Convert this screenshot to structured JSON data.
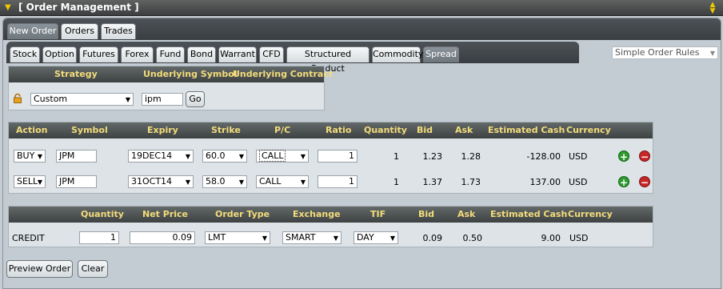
{
  "window": {
    "title": "[ Order Management ]"
  },
  "top_tabs": [
    "New Order",
    "Orders",
    "Trades"
  ],
  "instrument_tabs": [
    "Stock",
    "Option",
    "Futures",
    "Forex",
    "Fund",
    "Bond",
    "Warrant",
    "CFD",
    "Structured Product",
    "Commodity",
    "Spread"
  ],
  "rules_dropdown": "Simple Order Rules",
  "strategy": {
    "headers": [
      "Strategy",
      "Underlying Symbol",
      "Underlying Contract"
    ],
    "strategy_value": "Custom",
    "symbol_value": "ipm",
    "go_label": "Go"
  },
  "legs": {
    "headers": [
      "Action",
      "Symbol",
      "Expiry",
      "Strike",
      "P/C",
      "Ratio",
      "Quantity",
      "Bid",
      "Ask",
      "Estimated Cash",
      "Currency"
    ],
    "rows": [
      {
        "action": "BUY",
        "symbol": "JPM",
        "expiry": "19DEC14",
        "strike": "60.0",
        "pc": "CALL",
        "ratio": "1",
        "quantity": "1",
        "bid": "1.23",
        "ask": "1.28",
        "cash": "-128.00",
        "currency": "USD"
      },
      {
        "action": "SELL",
        "symbol": "JPM",
        "expiry": "31OCT14",
        "strike": "58.0",
        "pc": "CALL",
        "ratio": "1",
        "quantity": "1",
        "bid": "1.37",
        "ask": "1.73",
        "cash": "137.00",
        "currency": "USD"
      }
    ]
  },
  "order": {
    "headers": [
      "Quantity",
      "Net Price",
      "Order Type",
      "Exchange",
      "TIF",
      "Bid",
      "Ask",
      "Estimated Cash",
      "Currency"
    ],
    "row": {
      "type": "CREDIT",
      "quantity": "1",
      "net_price": "0.09",
      "order_type": "LMT",
      "exchange": "SMART",
      "tif": "DAY",
      "bid": "0.09",
      "ask": "0.50",
      "cash": "9.00",
      "currency": "USD"
    }
  },
  "buttons": {
    "preview": "Preview Order",
    "clear": "Clear"
  },
  "icons": {
    "collapse": "triangle-down",
    "scroll": "scroll-arrows",
    "lock": "lock-icon",
    "add": "plus-circle",
    "remove": "minus-circle"
  }
}
